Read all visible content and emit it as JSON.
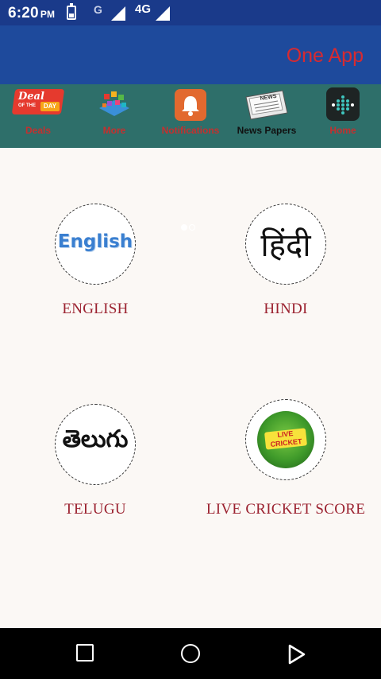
{
  "status_bar": {
    "time": "6:20",
    "ampm": "PM",
    "network_g": "G",
    "network_4g": "4G"
  },
  "header": {
    "title": "One App"
  },
  "nav_strip": {
    "items": [
      {
        "label": "Deals",
        "icon": "deals-icon",
        "deal_word": "Deal",
        "day_word": "DAY",
        "of_the": "OF THE"
      },
      {
        "label": "More",
        "icon": "more-apps-icon"
      },
      {
        "label": "Notifications",
        "icon": "bell-icon"
      },
      {
        "label": "News Papers",
        "icon": "newspaper-icon",
        "paper_word": "NEWS"
      },
      {
        "label": "Home",
        "icon": "home-dots-icon"
      }
    ],
    "pager": {
      "pages": 2,
      "active": 1
    }
  },
  "languages": [
    {
      "label": "ENGLISH",
      "glyph": "English"
    },
    {
      "label": "HINDI",
      "glyph": "हिंदी"
    },
    {
      "label": "TELUGU",
      "glyph": "తెలుగు"
    },
    {
      "label": "LIVE CRICKET SCORE",
      "glyph_line1": "LIVE",
      "glyph_line2": "CRICKET"
    }
  ],
  "colors": {
    "status_bar": "#1a3a8a",
    "header": "#1e4a9c",
    "title": "#d82a30",
    "nav_strip": "#2e6f6a",
    "label_red": "#9b2230",
    "background": "#fbf8f5"
  },
  "system_nav": {
    "buttons": [
      "square-icon",
      "circle-icon",
      "triangle-icon"
    ]
  }
}
